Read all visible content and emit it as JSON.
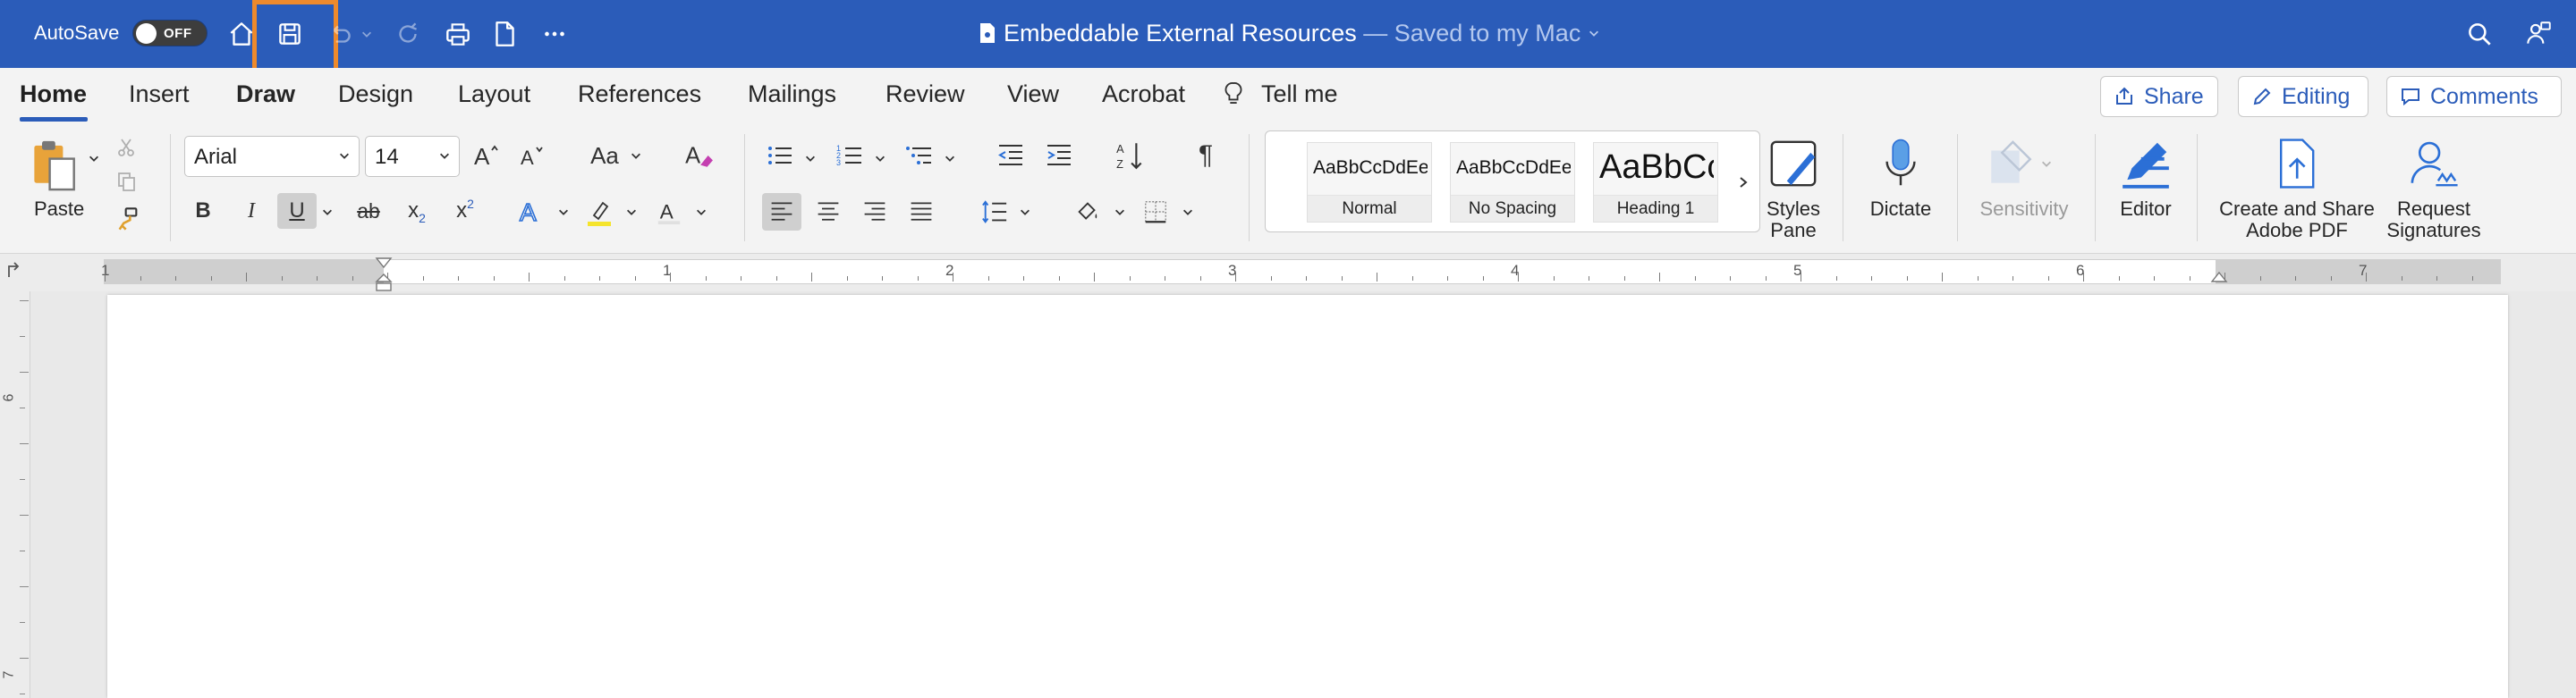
{
  "titlebar": {
    "autosave_label": "AutoSave",
    "autosave_state": "OFF",
    "doc_title": "Embeddable External Resources",
    "doc_status": "— Saved to my Mac",
    "icons": [
      "home-icon",
      "save-icon",
      "undo-icon",
      "redo-icon",
      "print-icon",
      "new-document-icon",
      "more-icon",
      "search-icon",
      "share-people-icon"
    ]
  },
  "tabs": {
    "items": [
      "Home",
      "Insert",
      "Draw",
      "Design",
      "Layout",
      "References",
      "Mailings",
      "Review",
      "View",
      "Acrobat",
      "Tell me"
    ],
    "active": "Home",
    "share_label": "Share",
    "editing_label": "Editing",
    "comments_label": "Comments"
  },
  "ribbon": {
    "paste_label": "Paste",
    "font_name": "Arial",
    "font_size": "14",
    "case_label": "Aa",
    "styles": [
      {
        "sample": "AaBbCcDdEe",
        "name": "Normal"
      },
      {
        "sample": "AaBbCcDdEe",
        "name": "No Spacing"
      },
      {
        "sample": "AaBbCc",
        "name": "Heading 1"
      }
    ],
    "styles_pane_label_1": "Styles",
    "styles_pane_label_2": "Pane",
    "dictate_label": "Dictate",
    "sensitivity_label": "Sensitivity",
    "editor_label": "Editor",
    "create_share_1": "Create and Share",
    "create_share_2": "Adobe PDF",
    "request_sig_1": "Request",
    "request_sig_2": "Signatures",
    "bold": "B",
    "italic": "I",
    "underline": "U",
    "strike": "ab",
    "subscript": "x",
    "superscript": "x",
    "pilcrow": "¶"
  },
  "ruler": {
    "numbers": [
      "1",
      "1",
      "2",
      "3",
      "4",
      "5",
      "6",
      "7"
    ],
    "vertical_numbers": [
      "6",
      "7"
    ]
  },
  "colors": {
    "titlebar": "#2b5cb9",
    "highlight_frame": "#ee8a2c",
    "accent": "#2b5cb9"
  }
}
